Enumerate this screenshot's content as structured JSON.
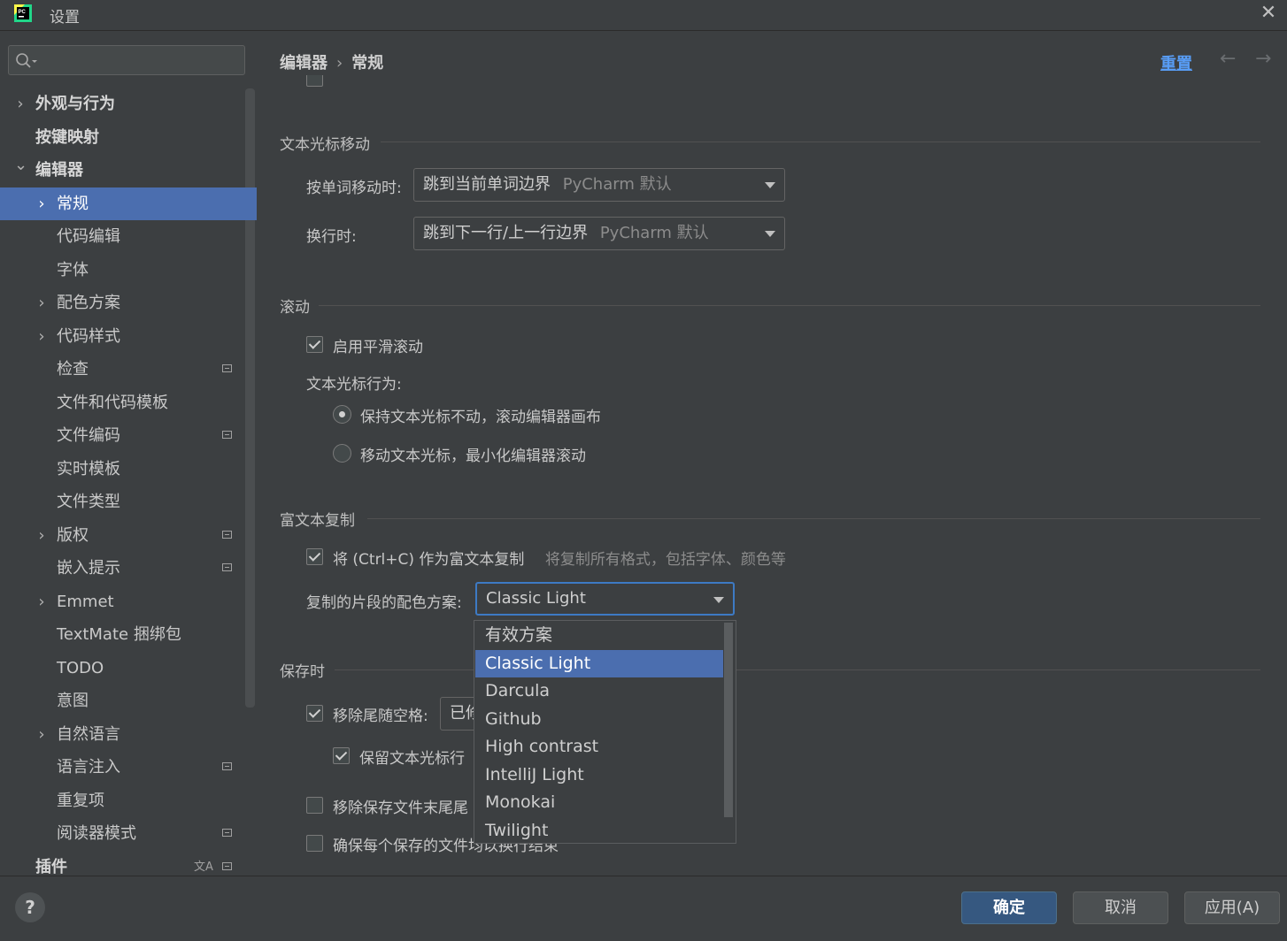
{
  "window": {
    "title": "设置",
    "app_icon": "pycharm-logo",
    "close_icon": "close-icon"
  },
  "search": {
    "placeholder": "",
    "icon": "search-icon"
  },
  "sidebar": {
    "items": [
      {
        "label": "外观与行为",
        "expandable": true,
        "expanded": false
      },
      {
        "label": "按键映射"
      },
      {
        "label": "编辑器",
        "expandable": true,
        "expanded": true
      },
      {
        "label": "常规",
        "expandable": true,
        "selected": true
      },
      {
        "label": "代码编辑"
      },
      {
        "label": "字体"
      },
      {
        "label": "配色方案",
        "expandable": true
      },
      {
        "label": "代码样式",
        "expandable": true
      },
      {
        "label": "检查",
        "project_icon": true
      },
      {
        "label": "文件和代码模板"
      },
      {
        "label": "文件编码",
        "project_icon": true
      },
      {
        "label": "实时模板"
      },
      {
        "label": "文件类型"
      },
      {
        "label": "版权",
        "expandable": true,
        "project_icon": true
      },
      {
        "label": "嵌入提示",
        "project_icon": true
      },
      {
        "label": "Emmet",
        "expandable": true
      },
      {
        "label": "TextMate 捆绑包"
      },
      {
        "label": "TODO"
      },
      {
        "label": "意图"
      },
      {
        "label": "自然语言",
        "expandable": true
      },
      {
        "label": "语言注入",
        "project_icon": true
      },
      {
        "label": "重复项"
      },
      {
        "label": "阅读器模式",
        "project_icon": true
      },
      {
        "label": "插件",
        "translate_icon": true,
        "project_icon": true
      }
    ]
  },
  "header": {
    "breadcrumb": [
      "编辑器",
      "常规"
    ],
    "breadcrumb_separator": "›",
    "reset_label": "重置",
    "back_icon": "arrow-left-icon",
    "forward_icon": "arrow-right-icon"
  },
  "content": {
    "caret_section": {
      "title": "文本光标移动",
      "word_move_label": "按单词移动时:",
      "word_move_value": "跳到当前单词边界",
      "word_move_hint": "PyCharm 默认",
      "line_change_label": "换行时:",
      "line_change_value": "跳到下一行/上一行边界",
      "line_change_hint": "PyCharm 默认"
    },
    "scroll_section": {
      "title": "滚动",
      "smooth_label": "启用平滑滚动",
      "smooth_checked": true,
      "caret_behavior_label": "文本光标行为:",
      "radio_keep": "保持文本光标不动，滚动编辑器画布",
      "radio_keep_selected": true,
      "radio_move": "移动文本光标，最小化编辑器滚动"
    },
    "rich_copy_section": {
      "title": "富文本复制",
      "rich_copy_label": "将 (Ctrl+C) 作为富文本复制",
      "rich_copy_checked": true,
      "rich_copy_hint": "将复制所有格式，包括字体、颜色等",
      "scheme_label": "复制的片段的配色方案:",
      "scheme_value": "Classic Light"
    },
    "save_section": {
      "title": "保存时",
      "strip_label": "移除尾随空格:",
      "strip_checked": true,
      "strip_value_partial": "已修",
      "keep_caret_label": "保留文本光标行",
      "keep_caret_checked": true,
      "remove_trailing_lines_label": "移除保存文件末尾尾",
      "remove_trailing_lines_checked": false,
      "ensure_newline_label": "确保每个保存的文件均以换行结束",
      "ensure_newline_checked": false
    }
  },
  "dropdown": {
    "options": [
      "有效方案",
      "Classic Light",
      "Darcula",
      "Github",
      "High contrast",
      "IntelliJ Light",
      "Monokai",
      "Twilight"
    ],
    "selected_index": 1
  },
  "footer": {
    "help_label": "?",
    "ok_label": "确定",
    "cancel_label": "取消",
    "apply_label": "应用(A)"
  },
  "colors": {
    "background": "#3c3f41",
    "selection": "#4b6eaf",
    "link": "#589df6",
    "primary_button": "#365880",
    "focus_border": "#3d7ac4"
  }
}
